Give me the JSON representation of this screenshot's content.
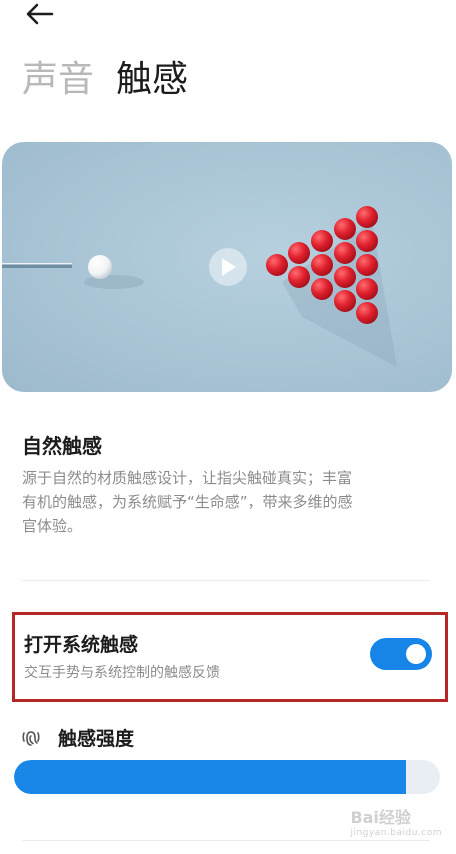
{
  "header": {
    "back_icon": "arrow-left-icon"
  },
  "tabs": [
    {
      "label": "声音",
      "active": false
    },
    {
      "label": "触感",
      "active": true
    }
  ],
  "hero": {
    "play_icon": "play-icon",
    "colors": {
      "background": "#a9c5d6",
      "balls": "#e0212e",
      "cue_ball": "#ffffff"
    }
  },
  "intro": {
    "title": "自然触感",
    "desc_line1": "源于自然的材质触感设计，让指尖触碰真实；丰富",
    "desc_line2": "有机的触感，为系统赋予“生命感”，带来多维的感",
    "desc_line3": "官体验。"
  },
  "haptics_toggle": {
    "title": "打开系统触感",
    "desc": "交互手势与系统控制的触感反馈",
    "enabled": true
  },
  "strength": {
    "icon": "fingerprint-vibration-icon",
    "label": "触感强度",
    "level": 0.92
  },
  "watermark": {
    "brand": "Bai经验",
    "url": "jingyan.baidu.com"
  },
  "colors": {
    "accent": "#1784e8",
    "highlight_border": "#b52626"
  }
}
